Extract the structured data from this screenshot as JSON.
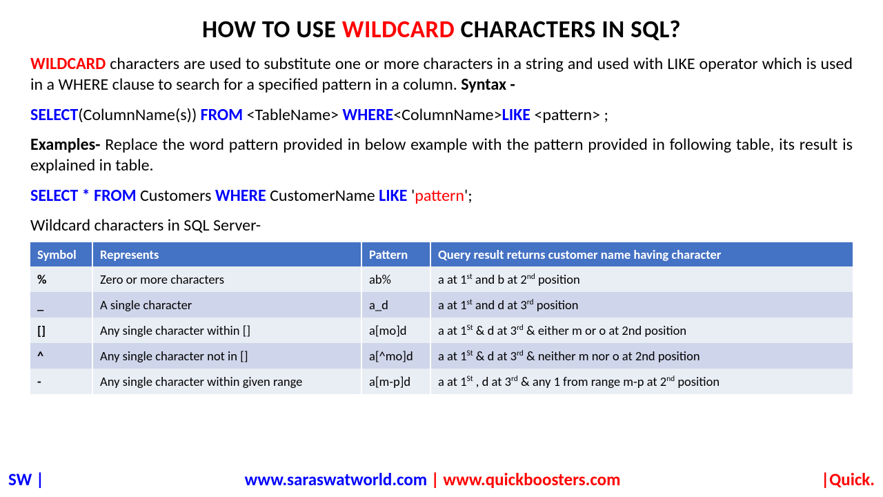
{
  "title": {
    "pre": "HOW TO USE ",
    "highlight": "WILDCARD",
    "post": " CHARACTERS IN SQL?"
  },
  "intro": {
    "highlight": "WILDCARD",
    "body": "  characters are used to substitute one or more characters in a string and used with LIKE operator  which is used in a WHERE clause to search for a specified pattern in a column. ",
    "syntax_label": "Syntax -"
  },
  "syntax": {
    "select": "SELECT",
    "cols": "(ColumnName(s)) ",
    "from": "FROM ",
    "table": "<TableName> ",
    "where": "WHERE",
    "colname": "<ColumnName>",
    "like": "LIKE ",
    "pattern": "<pattern> ;"
  },
  "examples": {
    "label": "Examples-",
    "body": "  Replace the word pattern provided in below example with the pattern provided in following table, its result is explained in table."
  },
  "example_query": {
    "select": "SELECT * FROM ",
    "table": "Customers ",
    "where": "WHERE ",
    "col": "CustomerName ",
    "like": "LIKE ",
    "q1": "'",
    "pattern": "pattern",
    "q2": "';"
  },
  "subhead": "Wildcard characters in SQL Server-",
  "table": {
    "headers": [
      "Symbol",
      "Represents",
      "Pattern",
      "Query result returns customer name having character"
    ],
    "rows": [
      {
        "sym": "%",
        "rep": "Zero or more characters",
        "pat": "ab%",
        "res_html": "a at 1<sup>st</sup> and b at 2<sup>nd</sup> position"
      },
      {
        "sym": "_",
        "rep": "A single character",
        "pat": "a_d",
        "res_html": "a at 1<sup>st</sup>  and d at 3<sup>rd</sup>  position"
      },
      {
        "sym": "[]",
        "rep": "Any single character within []",
        "pat": "a[mo]d",
        "res_html": "a at 1<sup>St</sup>  & d at 3<sup>rd</sup>  & either m or o at 2nd position"
      },
      {
        "sym": "^",
        "rep": "Any single character not in []",
        "pat": "a[^mo]d",
        "res_html": "a at 1<sup>St</sup>  & d at 3<sup>rd</sup>  & neither m nor o at 2nd position"
      },
      {
        "sym": "-",
        "rep": "Any single character within given range",
        "pat": "a[m-p]d",
        "res_html": "a at 1<sup>St</sup> , d at 3<sup>rd</sup>  & any 1 from range m-p at 2<sup>nd</sup> position"
      }
    ]
  },
  "footer": {
    "left": "SW |",
    "url1": "www.saraswatworld.com",
    "pipe": " | ",
    "url2": "www.quickboosters.com",
    "right": "|Quick."
  }
}
